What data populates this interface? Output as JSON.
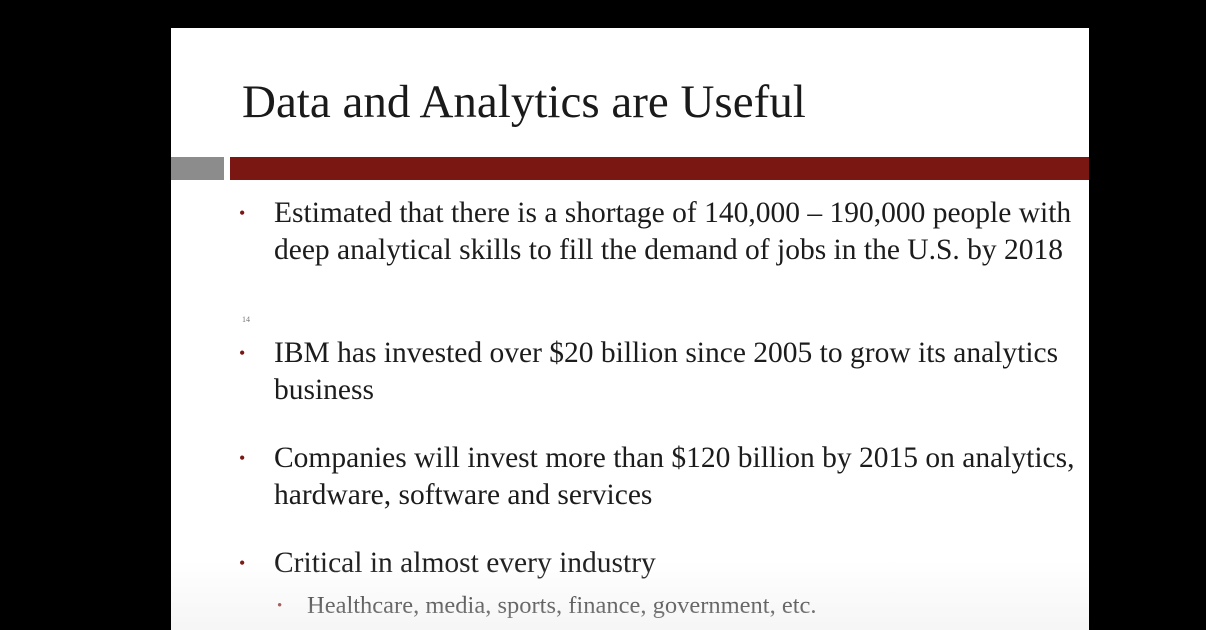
{
  "slide": {
    "title": "Data and Analytics are Useful",
    "slide_number": "14",
    "bullet_glyph": "•",
    "bullets": [
      {
        "text": "Estimated that there is a shortage of 140,000 – 190,000 people with deep analytical skills to fill the demand of jobs in the U.S. by 2018"
      },
      {
        "text": "IBM has invested over $20 billion since 2005 to grow its analytics business"
      },
      {
        "text": "Companies will invest more than $120 billion by 2015 on analytics, hardware, software and services"
      },
      {
        "text": "Critical in almost every industry",
        "sub_bullets": [
          {
            "text": "Healthcare, media, sports, finance, government, etc."
          }
        ]
      }
    ]
  },
  "colors": {
    "accent_bar": "#7a1712",
    "gray_bar": "#8c8c8c",
    "background": "#000000",
    "slide_background": "#ffffff"
  }
}
